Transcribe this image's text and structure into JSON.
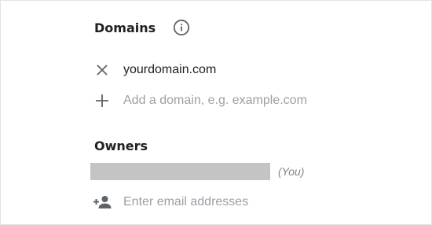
{
  "domains": {
    "title": "Domains",
    "info_icon": "info-circle-icon",
    "items": [
      {
        "value": "yourdomain.com",
        "remove_icon": "close-icon"
      }
    ],
    "add": {
      "icon": "plus-icon",
      "placeholder": "Add a domain, e.g. example.com"
    }
  },
  "owners": {
    "title": "Owners",
    "current_user": {
      "name_redacted": true,
      "suffix": "(You)"
    },
    "add": {
      "icon": "person-add-icon",
      "placeholder": "Enter email addresses"
    }
  },
  "colors": {
    "text": "#202124",
    "icon": "#5f6368",
    "placeholder": "#9aa0a6",
    "redaction": "#c4c4c4"
  }
}
